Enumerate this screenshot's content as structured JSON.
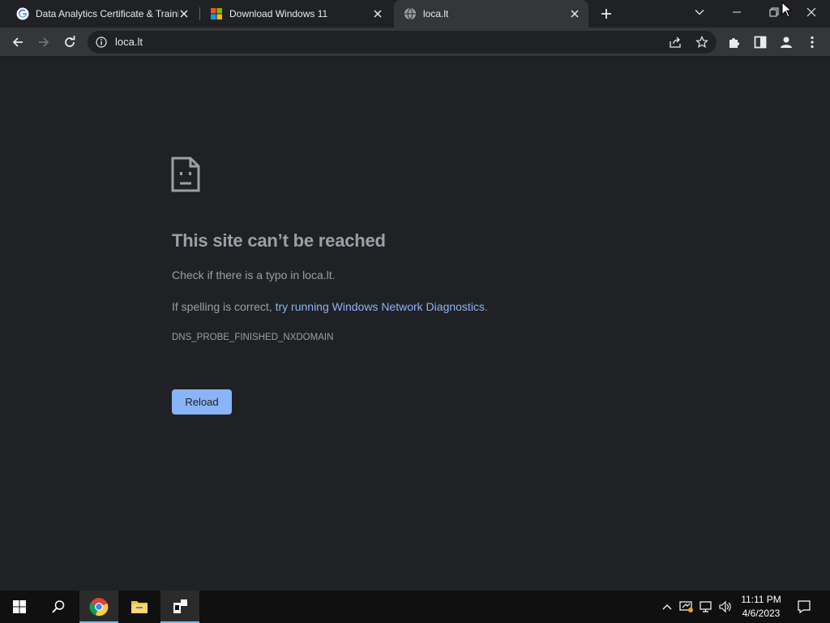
{
  "tabs": [
    {
      "title": "Data Analytics Certificate & Traini",
      "favicon": "google-g-icon"
    },
    {
      "title": "Download Windows 11",
      "favicon": "microsoft-logo-icon"
    },
    {
      "title": "loca.lt",
      "favicon": "globe-icon",
      "active": true
    }
  ],
  "window_controls": [
    "tab-search-icon",
    "minimize-icon",
    "restore-icon",
    "close-icon"
  ],
  "omnibox": {
    "url": "loca.lt",
    "icon": "info-icon"
  },
  "toolbar_icons": [
    "back-icon",
    "forward-icon",
    "reload-icon",
    "share-icon",
    "bookmark-star-icon",
    "extensions-icon",
    "side-panel-icon",
    "profile-icon",
    "menu-icon"
  ],
  "error": {
    "icon": "sad-page-icon",
    "title": "This site can’t be reached",
    "line1": "Check if there is a typo in loca.lt.",
    "line2_prefix": "If spelling is correct, ",
    "line2_link": "try running Windows Network Diagnostics",
    "line2_suffix": ".",
    "code": "DNS_PROBE_FINISHED_NXDOMAIN",
    "reload_label": "Reload"
  },
  "taskbar": {
    "items": [
      "windows-start-icon",
      "search-icon",
      "chrome-icon",
      "file-explorer-icon",
      "app-icon"
    ],
    "tray_icons": [
      "chevron-up-icon",
      "network-status-icon",
      "ethernet-icon",
      "volume-icon",
      "notification-icon"
    ],
    "time": "11:11 PM",
    "date": "4/6/2023"
  },
  "colors": {
    "background": "#202124",
    "toolbar": "#35363a",
    "link": "#8ab4f8",
    "text_secondary": "#9aa0a6",
    "button": "#8ab4f8"
  }
}
